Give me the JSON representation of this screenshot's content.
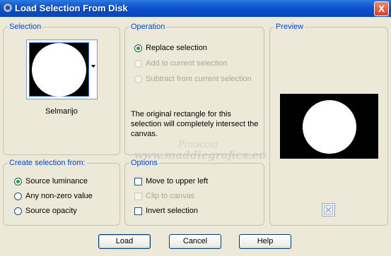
{
  "window": {
    "title": "Load Selection From Disk",
    "close_label": "X"
  },
  "selection": {
    "group_title": "Selection",
    "name": "Selmarijo"
  },
  "operation": {
    "group_title": "Operation",
    "options": [
      {
        "label": "Replace selection",
        "checked": true,
        "enabled": true
      },
      {
        "label": "Add to current selection",
        "checked": false,
        "enabled": false
      },
      {
        "label": "Subtract from current selection",
        "checked": false,
        "enabled": false
      }
    ],
    "message": "The original rectangle for this selection will completely intersect the canvas."
  },
  "preview": {
    "group_title": "Preview",
    "icon": "fit-icon"
  },
  "create_from": {
    "group_title": "Create selection from:",
    "options": [
      {
        "label": "Source luminance",
        "checked": true
      },
      {
        "label": "Any non-zero value",
        "checked": false
      },
      {
        "label": "Source opacity",
        "checked": false
      }
    ]
  },
  "options": {
    "group_title": "Options",
    "items": [
      {
        "label": "Move to upper left",
        "checked": false,
        "enabled": true
      },
      {
        "label": "Clip to canvas",
        "checked": false,
        "enabled": false
      },
      {
        "label": "Invert selection",
        "checked": false,
        "enabled": true
      }
    ]
  },
  "watermark": {
    "line1": "Pinuccia",
    "line2": "www.maddiegrafics.eu"
  },
  "buttons": {
    "load": "Load",
    "cancel": "Cancel",
    "help": "Help"
  },
  "colors": {
    "title_blue": "#0a4fc9",
    "group_title": "#0046d5",
    "dialog_bg": "#ece9d8",
    "radio_dot": "#21a121"
  }
}
